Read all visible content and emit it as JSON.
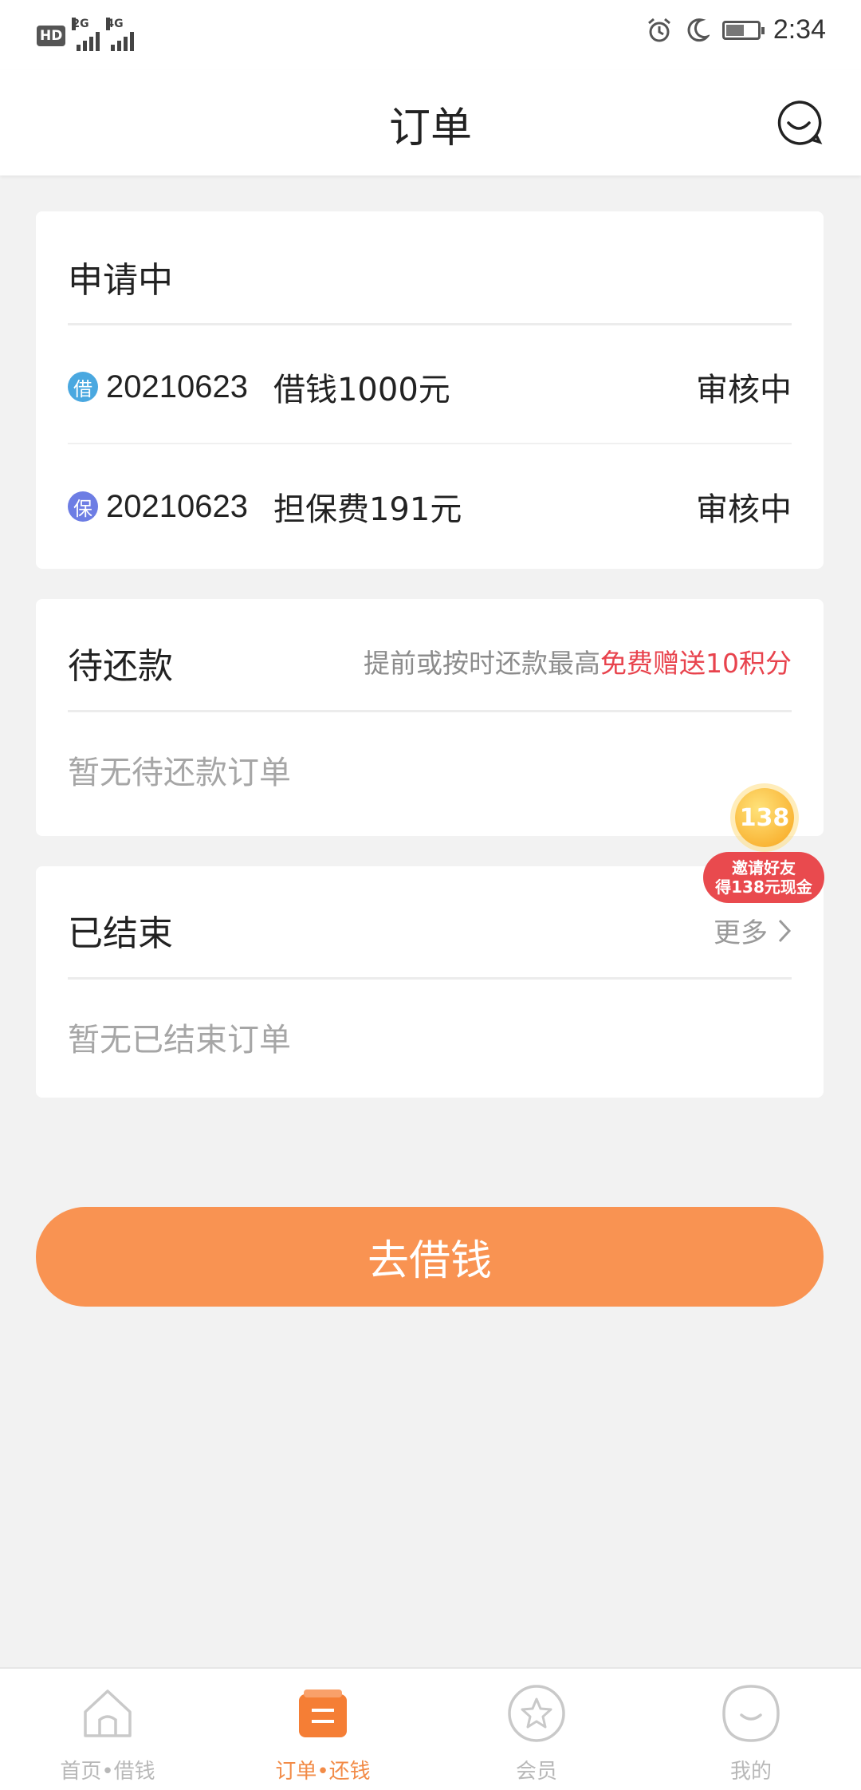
{
  "status_bar": {
    "hd_label": "HD",
    "hd_sub": "2",
    "net1": "2G",
    "net2": "4G",
    "time": "2:34"
  },
  "header": {
    "title": "订单"
  },
  "applying": {
    "title": "申请中",
    "rows": [
      {
        "badge": "借",
        "badge_color": "#4aa8e0",
        "date": "20210623",
        "desc": "借钱1000元",
        "status": "审核中"
      },
      {
        "badge": "保",
        "badge_color": "#6d7de4",
        "date": "20210623",
        "desc": "担保费191元",
        "status": "审核中"
      }
    ]
  },
  "pending": {
    "title": "待还款",
    "promo_prefix": "提前或按时还款最高",
    "promo_highlight": "免费赠送10积分",
    "empty": "暂无待还款订单"
  },
  "finished": {
    "title": "已结束",
    "more": "更多",
    "empty": "暂无已结束订单"
  },
  "invite": {
    "coin": "138",
    "line1": "邀请好友",
    "line2": "得138元现金"
  },
  "borrow_button": "去借钱",
  "tabs": [
    {
      "label": "首页•借钱",
      "icon": "home-icon"
    },
    {
      "label": "订单•还钱",
      "icon": "order-list-icon",
      "active": true
    },
    {
      "label": "会员",
      "icon": "star-icon"
    },
    {
      "label": "我的",
      "icon": "smile-icon"
    }
  ],
  "colors": {
    "accent": "#f99352",
    "active_tab": "#f28b47",
    "highlight_red": "#e8434d"
  }
}
